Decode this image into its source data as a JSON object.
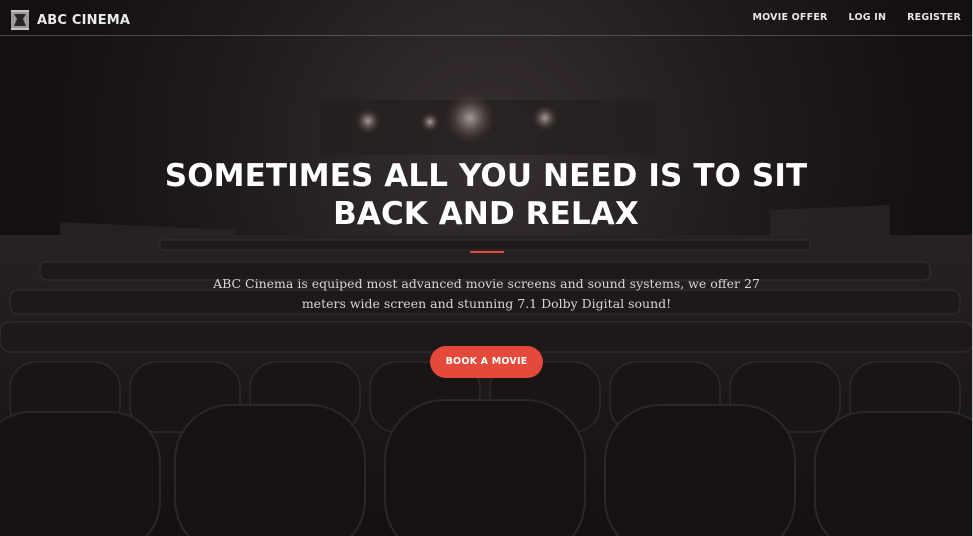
{
  "brand": {
    "name": "ABC CINEMA",
    "logo_icon": "cinema-frame-icon"
  },
  "nav": {
    "items": [
      {
        "label": "MOVIE OFFER"
      },
      {
        "label": "LOG IN"
      },
      {
        "label": "REGISTER"
      }
    ]
  },
  "hero": {
    "headline": "SOMETIMES ALL YOU NEED IS TO SIT BACK AND RELAX",
    "description": "ABC Cinema is equiped most advanced movie screens and sound systems, we offer 27 meters wide screen and stunning 7.1 Dolby Digital sound!",
    "cta_label": "BOOK A MOVIE",
    "background": "cinema-seats-photo"
  },
  "colors": {
    "accent": "#e5493b",
    "overlay": "#1d1818",
    "text": "#ffffff"
  }
}
